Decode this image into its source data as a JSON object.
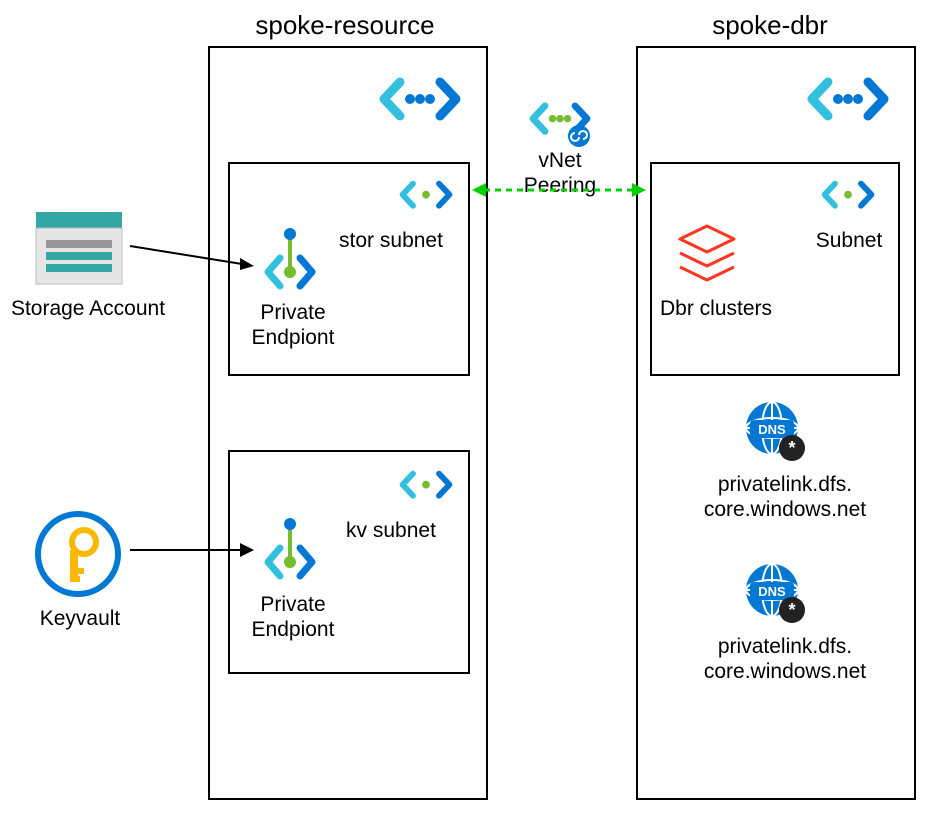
{
  "titles": {
    "spoke_resource": "spoke-resource",
    "spoke_dbr": "spoke-dbr"
  },
  "labels": {
    "storage_account": "Storage Account",
    "keyvault": "Keyvault",
    "vnet_peering": "vNet Peering",
    "private_endpoint_1": "Private\nEndpiont",
    "private_endpoint_2": "Private\nEndpiont",
    "stor_subnet": "stor subnet",
    "kv_subnet": "kv subnet",
    "subnet": "Subnet",
    "dbr_clusters": "Dbr clusters",
    "dns1": "privatelink.dfs.\ncore.windows.net",
    "dns2": "privatelink.dfs.\ncore.windows.net"
  },
  "colors": {
    "azure_blue": "#0078D4",
    "azure_cyan": "#32BEDD",
    "azure_teal": "#33A7A3",
    "databricks_red": "#FF3621",
    "dns_blue": "#0078D4",
    "star_bg": "#222222",
    "key_yellow": "#FAB900",
    "green_arrow": "#00D000"
  }
}
